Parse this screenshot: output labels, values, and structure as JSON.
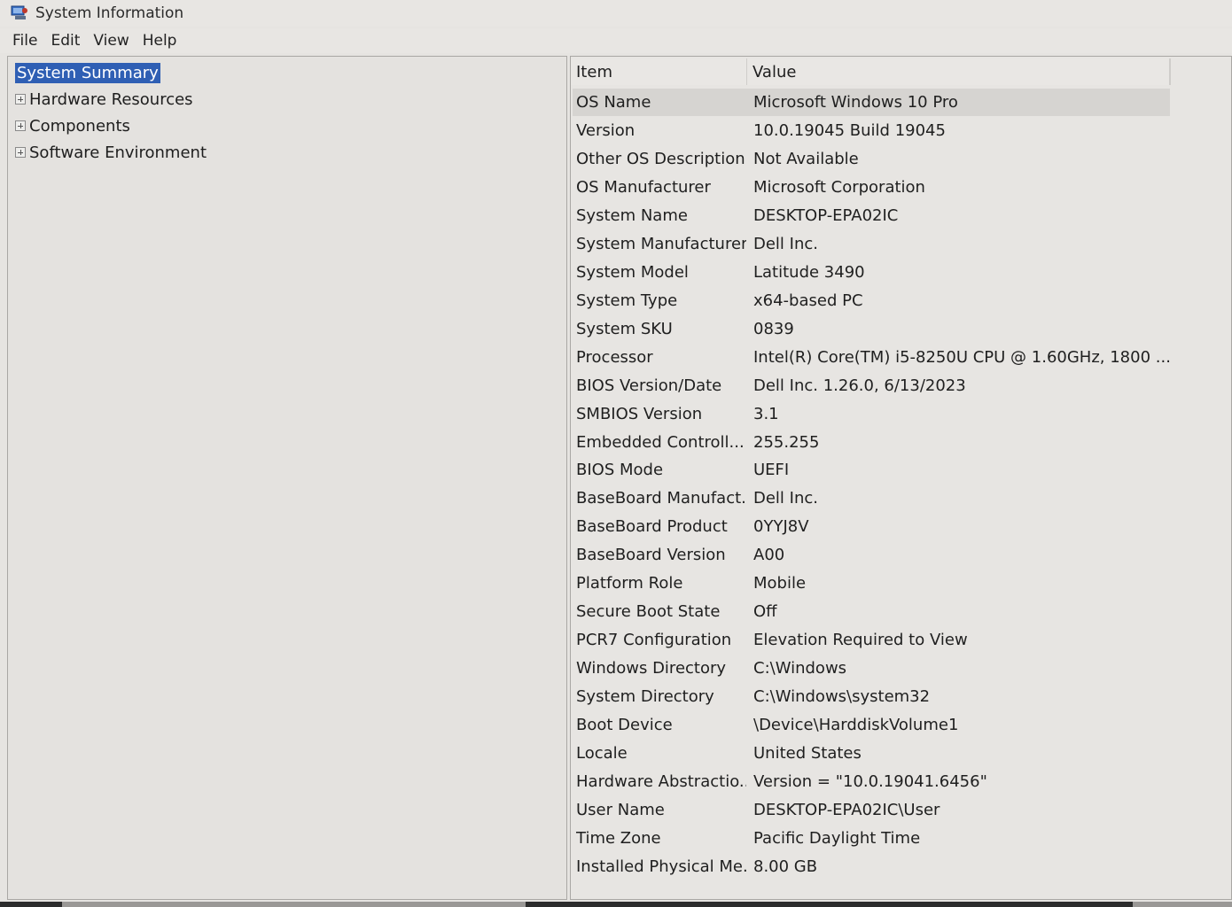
{
  "window": {
    "title": "System Information"
  },
  "menu": [
    "File",
    "Edit",
    "View",
    "Help"
  ],
  "tree": [
    {
      "label": "System Summary",
      "selected": true,
      "expandable": false
    },
    {
      "label": "Hardware Resources",
      "selected": false,
      "expandable": true
    },
    {
      "label": "Components",
      "selected": false,
      "expandable": true
    },
    {
      "label": "Software Environment",
      "selected": false,
      "expandable": true
    }
  ],
  "table": {
    "headers": {
      "item": "Item",
      "value": "Value"
    },
    "rows": [
      {
        "item": "OS Name",
        "value": "Microsoft Windows 10 Pro"
      },
      {
        "item": "Version",
        "value": "10.0.19045 Build 19045"
      },
      {
        "item": "Other OS Description",
        "value": "Not Available"
      },
      {
        "item": "OS Manufacturer",
        "value": "Microsoft Corporation"
      },
      {
        "item": "System Name",
        "value": "DESKTOP-EPA02IC"
      },
      {
        "item": "System Manufacturer",
        "value": "Dell Inc."
      },
      {
        "item": "System Model",
        "value": "Latitude 3490"
      },
      {
        "item": "System Type",
        "value": "x64-based PC"
      },
      {
        "item": "System SKU",
        "value": "0839"
      },
      {
        "item": "Processor",
        "value": "Intel(R) Core(TM) i5-8250U CPU @ 1.60GHz, 1800 ..."
      },
      {
        "item": "BIOS Version/Date",
        "value": "Dell Inc. 1.26.0, 6/13/2023"
      },
      {
        "item": "SMBIOS Version",
        "value": "3.1"
      },
      {
        "item": "Embedded Controll...",
        "value": "255.255"
      },
      {
        "item": "BIOS Mode",
        "value": "UEFI"
      },
      {
        "item": "BaseBoard Manufact...",
        "value": "Dell Inc."
      },
      {
        "item": "BaseBoard Product",
        "value": "0YYJ8V"
      },
      {
        "item": "BaseBoard Version",
        "value": "A00"
      },
      {
        "item": "Platform Role",
        "value": "Mobile"
      },
      {
        "item": "Secure Boot State",
        "value": "Off"
      },
      {
        "item": "PCR7 Configuration",
        "value": "Elevation Required to View"
      },
      {
        "item": "Windows Directory",
        "value": "C:\\Windows"
      },
      {
        "item": "System Directory",
        "value": "C:\\Windows\\system32"
      },
      {
        "item": "Boot Device",
        "value": "\\Device\\HarddiskVolume1"
      },
      {
        "item": "Locale",
        "value": "United States"
      },
      {
        "item": "Hardware Abstractio...",
        "value": "Version = \"10.0.19041.6456\""
      },
      {
        "item": "User Name",
        "value": "DESKTOP-EPA02IC\\User"
      },
      {
        "item": "Time Zone",
        "value": "Pacific Daylight Time"
      },
      {
        "item": "Installed Physical Me...",
        "value": "8.00 GB"
      }
    ]
  },
  "colors": {
    "selection": "#2f5fb4",
    "window_bg": "#e6e4e1"
  },
  "icons": {
    "app": "system-information-icon",
    "expander": "plus-box-icon"
  }
}
